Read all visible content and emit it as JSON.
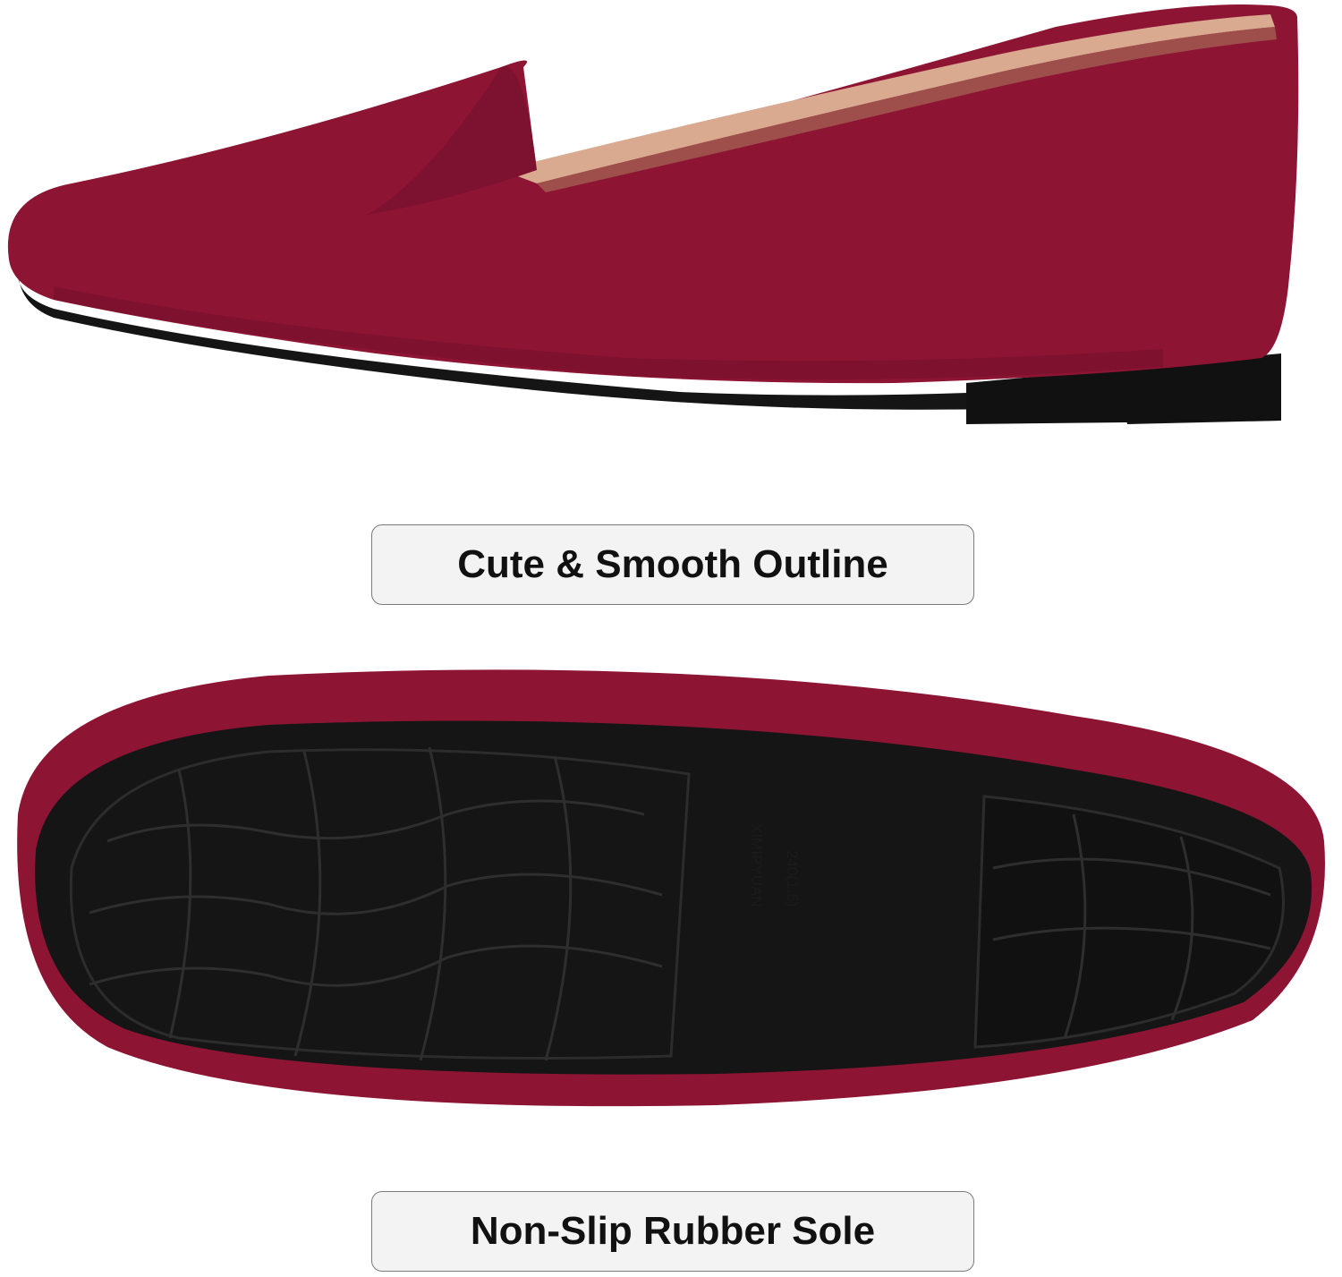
{
  "captions": {
    "top": "Cute & Smooth Outline",
    "bottom": "Non-Slip Rubber Sole"
  },
  "sole_print": {
    "brand": "XIMIPYUAN",
    "size": "240(1.5)"
  },
  "colors": {
    "suede": "#8e1434",
    "suede_dark": "#6d0e27",
    "lining": "#d9aa90",
    "rubber": "#151515",
    "caption_bg": "#f3f3f3",
    "caption_border": "#7a7a7a"
  }
}
